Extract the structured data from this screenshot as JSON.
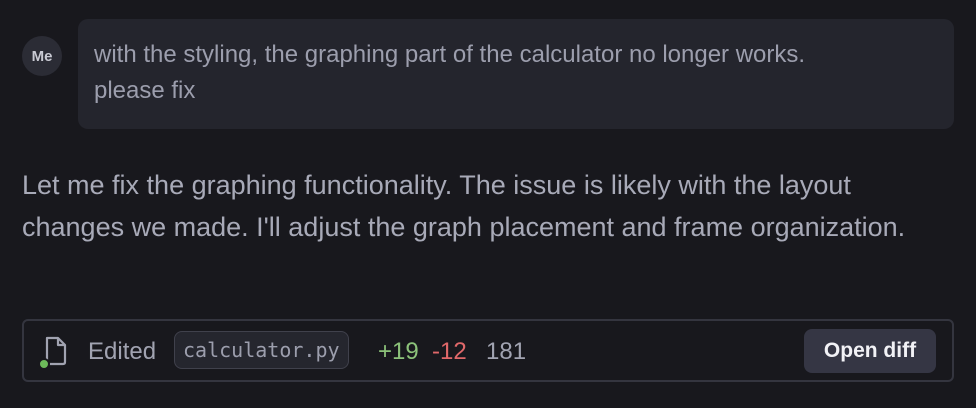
{
  "user_message": {
    "avatar_label": "Me",
    "text": "with the styling, the graphing part of the calculator no longer works.\nplease fix"
  },
  "assistant_message": {
    "text": "Let me fix the graphing functionality. The issue is likely with the layout changes we made. I'll adjust the graph placement and frame organization."
  },
  "edit_card": {
    "icon": "file-icon",
    "status_label": "Edited",
    "file_name": "calculator.py",
    "additions": "+19",
    "deletions": "-12",
    "line_count": "181",
    "open_diff_label": "Open diff"
  },
  "colors": {
    "background": "#18181d",
    "bubble": "#24252d",
    "additions": "#8cc27a",
    "deletions": "#e0686a",
    "status_dot": "#6dbb5a",
    "button": "#353644"
  }
}
